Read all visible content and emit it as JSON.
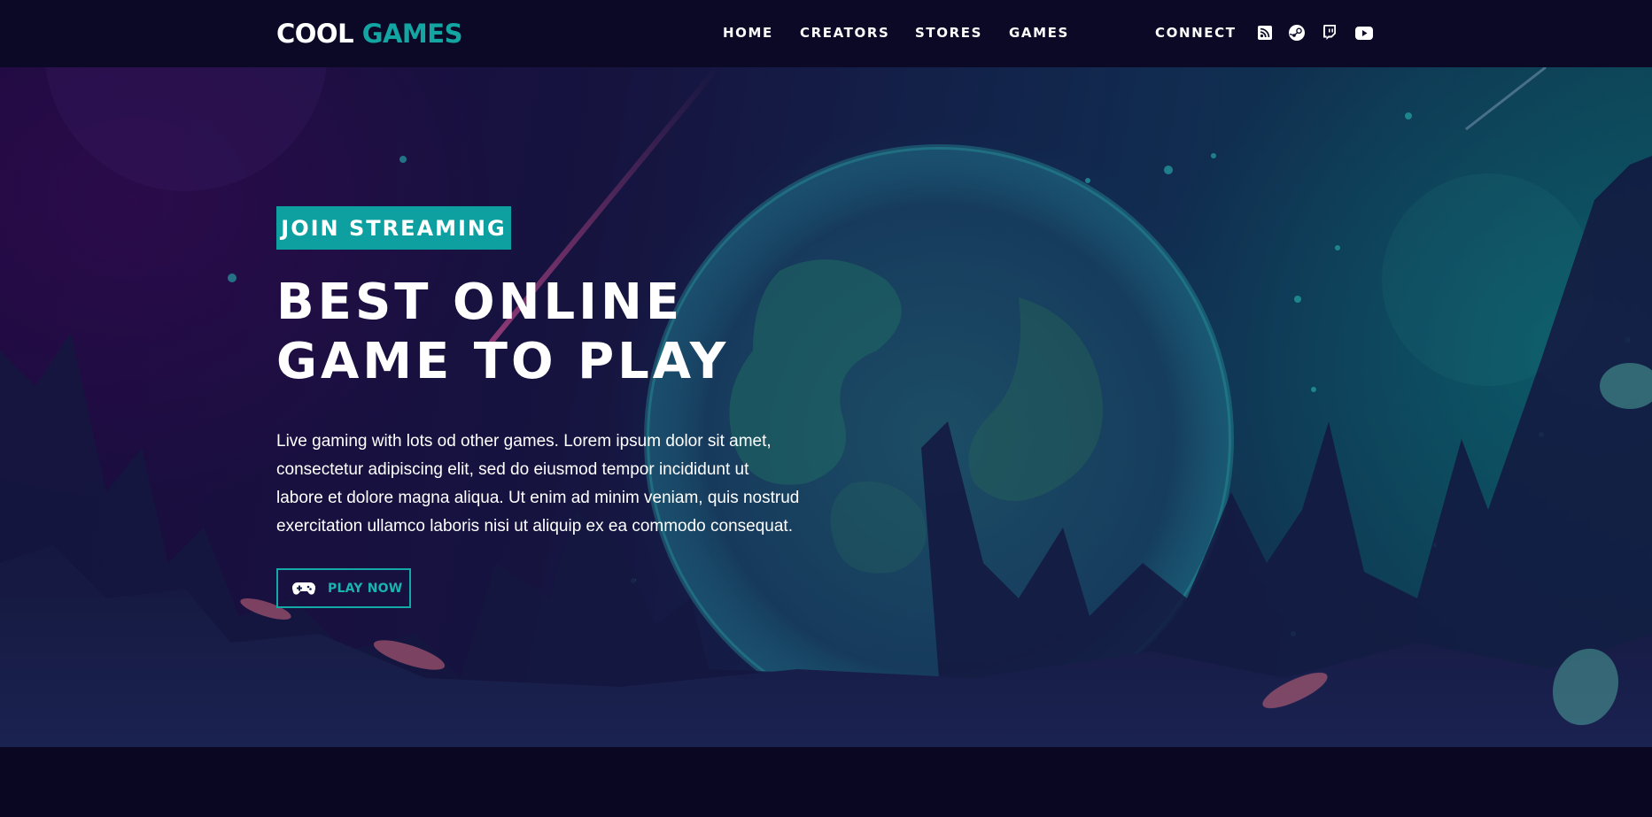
{
  "brand": {
    "logo_part1": "COOL",
    "logo_part2": "GAMES",
    "accent_color": "#12a5a2"
  },
  "nav": {
    "links": [
      {
        "label": "HOME"
      },
      {
        "label": "CREATORS"
      },
      {
        "label": "STORES"
      },
      {
        "label": "GAMES"
      }
    ],
    "connect_label": "CONNECT",
    "social_icons": [
      "rss-icon",
      "steam-icon",
      "twitch-icon",
      "youtube-icon"
    ]
  },
  "hero": {
    "badge": "JOIN STREAMING",
    "headline_lines": [
      "BEST ONLINE",
      "GAME TO PLAY"
    ],
    "description_lines": [
      "Live gaming with lots od other games. Lorem ipsum dolor sit amet,",
      "consectetur adipiscing elit, sed do eiusmod tempor incididunt ut",
      "labore et dolore magna aliqua. Ut enim ad minim veniam, quis nostrud",
      "exercitation ullamco laboris nisi ut aliquip ex ea commodo consequat."
    ],
    "cta_label": "PLAY NOW",
    "cta_icon": "gamepad-icon"
  }
}
